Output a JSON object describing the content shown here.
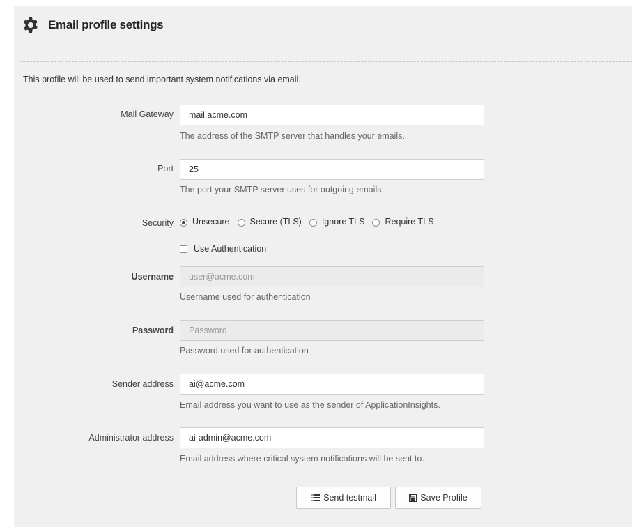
{
  "header": {
    "title": "Email profile settings",
    "icon": "gear-icon"
  },
  "intro": "This profile will be used to send important system notifications via email.",
  "fields": {
    "gateway": {
      "label": "Mail Gateway",
      "value": "mail.acme.com",
      "help": "The address of the SMTP server that handles your emails."
    },
    "port": {
      "label": "Port",
      "value": "25",
      "help": "The port your SMTP server uses for outgoing emails."
    },
    "security": {
      "label": "Security",
      "options": [
        "Unsecure",
        "Secure (TLS)",
        "Ignore TLS",
        "Require TLS"
      ],
      "selected": "Unsecure"
    },
    "auth": {
      "label": "Use Authentication",
      "checked": false
    },
    "username": {
      "label": "Username",
      "placeholder": "user@acme.com",
      "help": "Username used for authentication"
    },
    "password": {
      "label": "Password",
      "placeholder": "Password",
      "help": "Password used for authentication"
    },
    "sender": {
      "label": "Sender address",
      "value": "ai@acme.com",
      "help": "Email address you want to use as the sender of ApplicationInsights."
    },
    "admin": {
      "label": "Administrator address",
      "value": "ai-admin@acme.com",
      "help": "Email address where critical system notifications will be sent to."
    }
  },
  "buttons": {
    "send_test": {
      "label": "Send testmail",
      "icon": "mail-list-icon"
    },
    "save": {
      "label": "Save Profile",
      "icon": "floppy-disk-icon"
    }
  }
}
